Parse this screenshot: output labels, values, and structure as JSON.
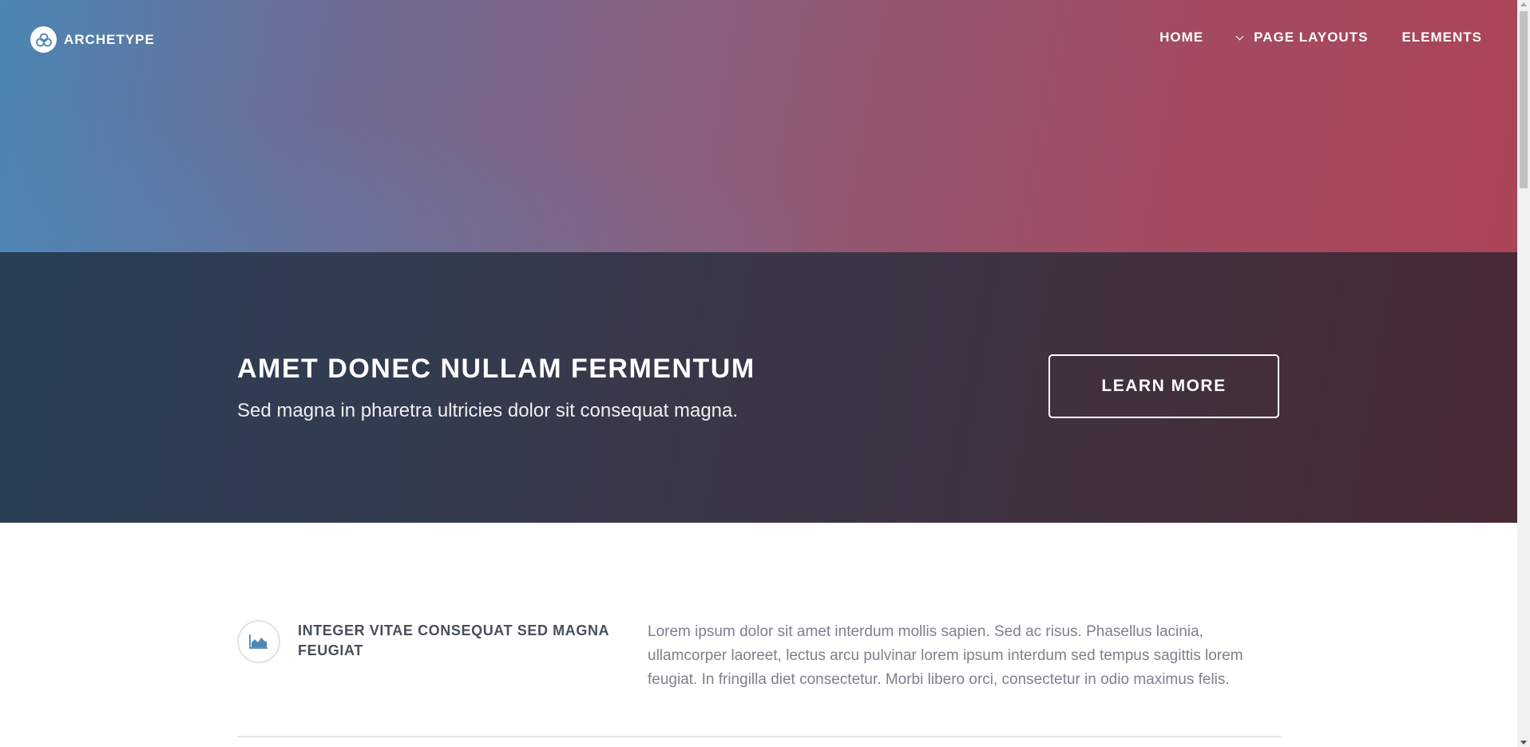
{
  "header": {
    "logo_text": "ARCHETYPE",
    "nav": {
      "home": "HOME",
      "page_layouts": "PAGE LAYOUTS",
      "elements": "ELEMENTS"
    }
  },
  "banner": {
    "title": "AMET DONEC NULLAM FERMENTUM",
    "subtitle": "Sed magna in pharetra ultricies dolor sit consequat magna.",
    "button_label": "LEARN MORE"
  },
  "feature": {
    "icon": "area-chart-icon",
    "title": "INTEGER VITAE CONSEQUAT SED MAGNA FEUGIAT",
    "text": "Lorem ipsum dolor sit amet interdum mollis sapien. Sed ac risus. Phasellus lacinia, ullamcorper laoreet, lectus arcu pulvinar lorem ipsum interdum sed tempus sagittis lorem feugiat. In fringilla diet consectetur. Morbi libero orci, consectetur in odio maximus felis."
  },
  "colors": {
    "accent_blue": "#4c86b3",
    "accent_red": "#ac4458",
    "banner_dark": "#353a4d"
  }
}
